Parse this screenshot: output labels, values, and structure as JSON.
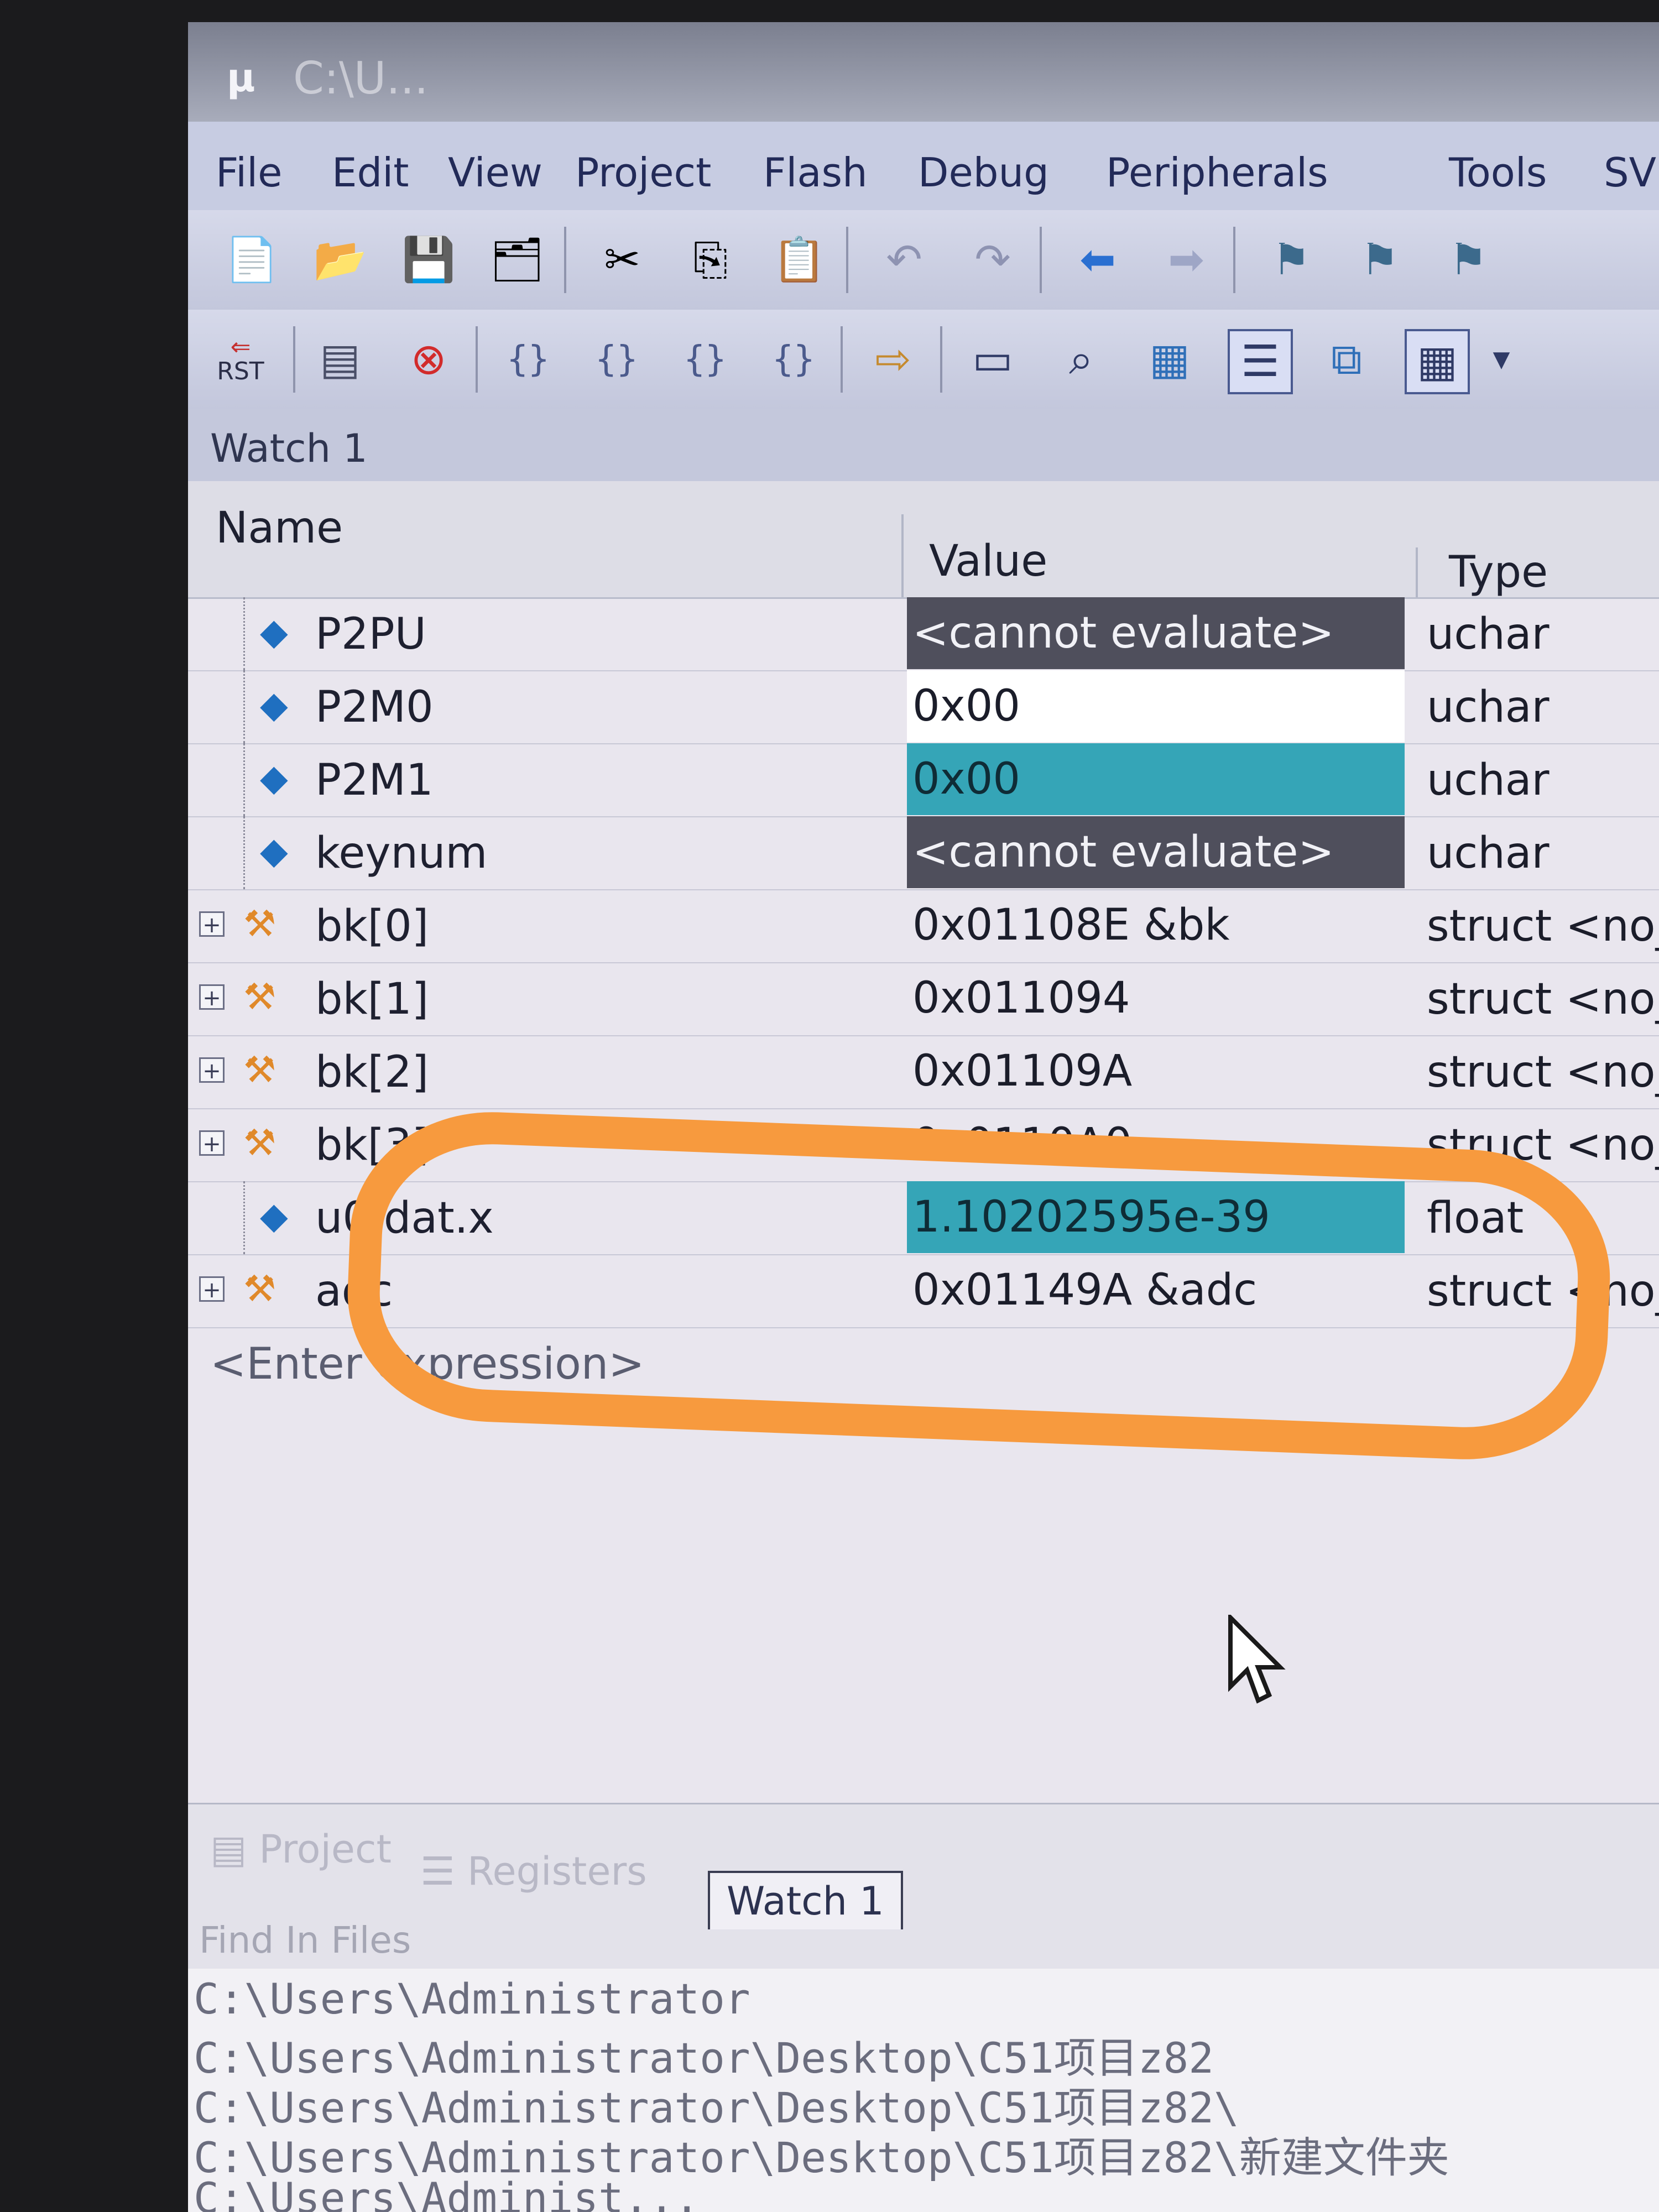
{
  "window": {
    "title": "C:\\U..."
  },
  "menu": [
    "File",
    "Edit",
    "View",
    "Project",
    "Flash",
    "Debug",
    "Peripherals",
    "Tools",
    "SV"
  ],
  "toolbar_icons": {
    "row1": [
      "new-file-icon",
      "open-folder-icon",
      "save-icon",
      "save-all-icon",
      "cut-icon",
      "copy-icon",
      "paste-icon",
      "undo-icon",
      "redo-icon",
      "back-arrow-icon",
      "forward-arrow-icon",
      "bookmark-icon",
      "bookmark-prev-icon",
      "bookmark-next-icon"
    ],
    "row2": [
      "reset-icon",
      "view-icon",
      "stop-icon",
      "step-into-icon",
      "step-over-icon",
      "step-out-icon",
      "run-to-cursor-icon",
      "show-next-statement-icon",
      "command-window-icon",
      "disassembly-icon",
      "symbols-icon",
      "registers-icon",
      "call-stack-icon",
      "watch-window-icon"
    ]
  },
  "toolbar_labels": {
    "reset": "RST"
  },
  "watch": {
    "title": "Watch 1",
    "columns": {
      "name": "Name",
      "value": "Value",
      "type": "Type"
    },
    "rows": [
      {
        "name": "P2PU",
        "value": "<cannot evaluate>",
        "type": "uchar",
        "icon": "variable-icon",
        "value_style": "dark"
      },
      {
        "name": "P2M0",
        "value": "0x00",
        "type": "uchar",
        "icon": "variable-icon",
        "value_style": "white"
      },
      {
        "name": "P2M1",
        "value": "0x00",
        "type": "uchar",
        "icon": "variable-icon",
        "value_style": "teal"
      },
      {
        "name": "keynum",
        "value": "<cannot evaluate>",
        "type": "uchar",
        "icon": "variable-icon",
        "value_style": "dark"
      },
      {
        "name": "bk[0]",
        "value": "0x01108E &bk",
        "type": "struct <no_ta",
        "icon": "struct-icon",
        "expandable": true
      },
      {
        "name": "bk[1]",
        "value": "0x011094",
        "type": "struct <no_tag",
        "icon": "struct-icon",
        "expandable": true
      },
      {
        "name": "bk[2]",
        "value": "0x01109A",
        "type": "struct <no_tag",
        "icon": "struct-icon",
        "expandable": true
      },
      {
        "name": "bk[3]",
        "value": "0x0110A0",
        "type": "struct <no_tag>",
        "icon": "struct-icon",
        "expandable": true
      },
      {
        "name": "u0.dat.x",
        "value": "1.10202595e-39",
        "type": "float",
        "icon": "variable-icon",
        "value_style": "teal"
      },
      {
        "name": "adc",
        "value": "0x01149A &adc",
        "type": "struct <no_tag>",
        "icon": "struct-icon",
        "expandable": true
      },
      {
        "name": "<Enter expression>",
        "value": "",
        "type": ""
      }
    ]
  },
  "annotation": {
    "color": "#f79a3e"
  },
  "bottom_tabs": [
    {
      "label": "Project",
      "active": false
    },
    {
      "label": "Registers",
      "active": false
    },
    {
      "label": "Watch 1",
      "active": true
    }
  ],
  "find_in_files": "Find In Files",
  "output_lines": [
    "C:\\Users\\Administrator",
    "C:\\Users\\Administrator\\Desktop\\C51项目z82",
    "C:\\Users\\Administrator\\Desktop\\C51项目z82\\",
    "C:\\Users\\Administrator\\Desktop\\C51项目z82\\新建文件夹",
    "C:\\Users\\Administ..."
  ]
}
